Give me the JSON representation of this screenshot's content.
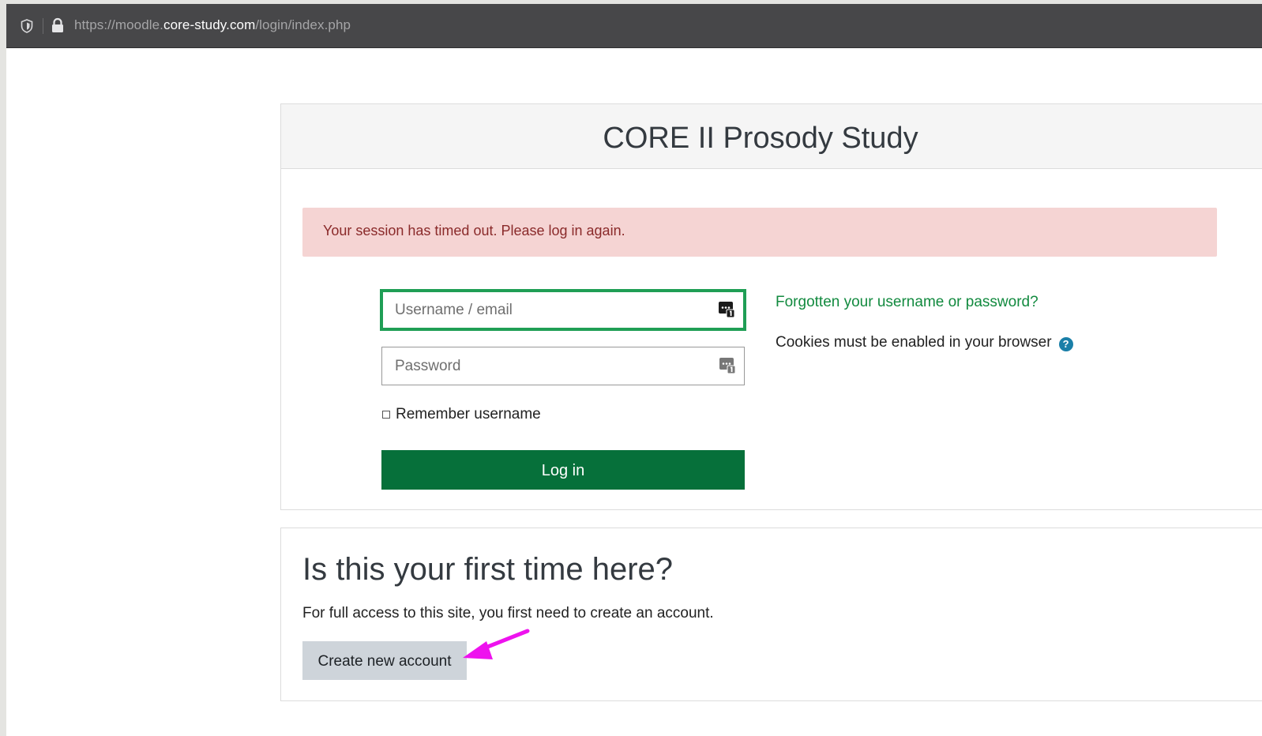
{
  "browser": {
    "url_prefix": "https://moodle.",
    "url_host": "core-study.com",
    "url_path": "/login/index.php"
  },
  "login": {
    "site_title": "CORE II Prosody Study",
    "alert": "Your session has timed out. Please log in again.",
    "username_placeholder": "Username / email",
    "password_placeholder": "Password",
    "remember_label": "Remember username",
    "login_button": "Log in",
    "forgot_link": "Forgotten your username or password?",
    "cookies_text": "Cookies must be enabled in your browser",
    "help_icon": "question-circle"
  },
  "signup": {
    "heading": "Is this your first time here?",
    "description": "For full access to this site, you first need to create an account.",
    "create_button": "Create new account"
  },
  "colors": {
    "primary_green": "#06703a",
    "focus_border": "#1f9e55",
    "alert_bg": "#f5d4d3",
    "alert_text": "#8a2a2a",
    "annotation_arrow": "#ee12ee"
  }
}
